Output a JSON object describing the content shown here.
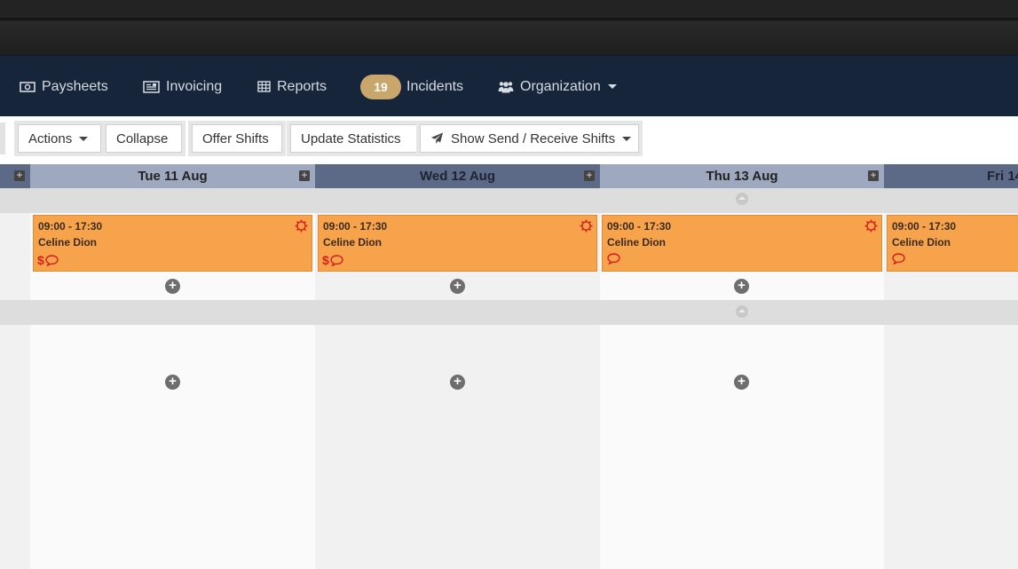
{
  "nav": {
    "items": [
      {
        "label": "Paysheets",
        "icon": "money-icon"
      },
      {
        "label": "Invoicing",
        "icon": "newspaper-icon"
      },
      {
        "label": "Reports",
        "icon": "table-icon"
      },
      {
        "label": "Incidents",
        "icon": "badge",
        "badge": "19"
      },
      {
        "label": "Organization",
        "icon": "users-icon"
      }
    ]
  },
  "toolbar": {
    "actions": "Actions",
    "collapse": "Collapse",
    "offer_shifts": "Offer Shifts",
    "update_statistics": "Update Statistics",
    "send_receive": "Show Send / Receive Shifts"
  },
  "days": [
    {
      "label": "Tue 11 Aug"
    },
    {
      "label": "Wed 12 Aug"
    },
    {
      "label": "Thu 13 Aug"
    },
    {
      "label": "Fri 14"
    }
  ],
  "shifts": [
    {
      "time": "09:00 - 17:30",
      "name": "Celine Dion",
      "dollar": "$"
    },
    {
      "time": "09:00 - 17:30",
      "name": "Celine Dion",
      "dollar": "$"
    },
    {
      "time": "09:00 - 17:30",
      "name": "Celine Dion",
      "dollar": ""
    },
    {
      "time": "09:00 - 17:30",
      "name": "Celine Dion",
      "dollar": ""
    }
  ],
  "colors": {
    "navbar": "#16253a",
    "badge": "#c9a66b",
    "shift": "#f7a34b",
    "alert": "#d42020"
  }
}
